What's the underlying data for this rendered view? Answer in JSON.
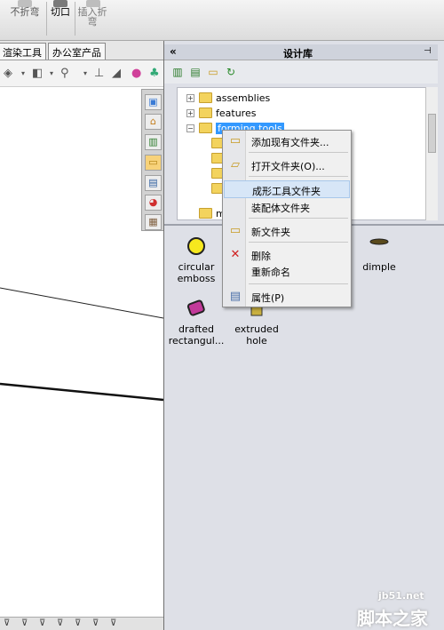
{
  "ribbon": {
    "buttons": [
      {
        "label": "不折弯"
      },
      {
        "label": "切口"
      },
      {
        "label": "插入折弯"
      }
    ]
  },
  "tabs": [
    {
      "label": "渲染工具"
    },
    {
      "label": "办公室产品"
    }
  ],
  "design_library": {
    "title": "设计库",
    "collapse_glyph": "«",
    "pin_glyph": "⊣",
    "tree": [
      {
        "label": "assemblies",
        "expander": "+"
      },
      {
        "label": "features",
        "expander": "+"
      },
      {
        "label": "forming tools",
        "expander": "−",
        "selected": true
      },
      {
        "label": ""
      },
      {
        "label": ""
      },
      {
        "label": ""
      },
      {
        "label": ""
      },
      {
        "label": "m"
      }
    ],
    "items": [
      {
        "label": "circular emboss",
        "color": "#f6e81e"
      },
      {
        "label": "dimple",
        "color": "#5a4a1c"
      },
      {
        "label": "drafted rectangul...",
        "color": "#c23a9a"
      },
      {
        "label": "extruded hole",
        "color": "#c9b040"
      }
    ]
  },
  "context_menu": {
    "items": [
      {
        "label": "添加现有文件夹...",
        "icon": "add-folder-icon"
      },
      {
        "label": "打开文件夹(O)...",
        "icon": "open-folder-icon"
      },
      {
        "label": "成形工具文件夹",
        "icon": "",
        "hover": true
      },
      {
        "label": "装配体文件夹",
        "icon": ""
      },
      {
        "label": "新文件夹",
        "icon": "new-folder-icon"
      },
      {
        "label": "删除",
        "icon": "delete-icon"
      },
      {
        "label": "重新命名",
        "icon": ""
      },
      {
        "label": "属性(P)",
        "icon": "properties-icon"
      }
    ]
  },
  "watermark": {
    "url": "jb51.net",
    "text": "脚本之家"
  },
  "colors": {
    "selection": "#3399ff",
    "pane_bg": "#dee0e7",
    "delete_red": "#d02020"
  }
}
